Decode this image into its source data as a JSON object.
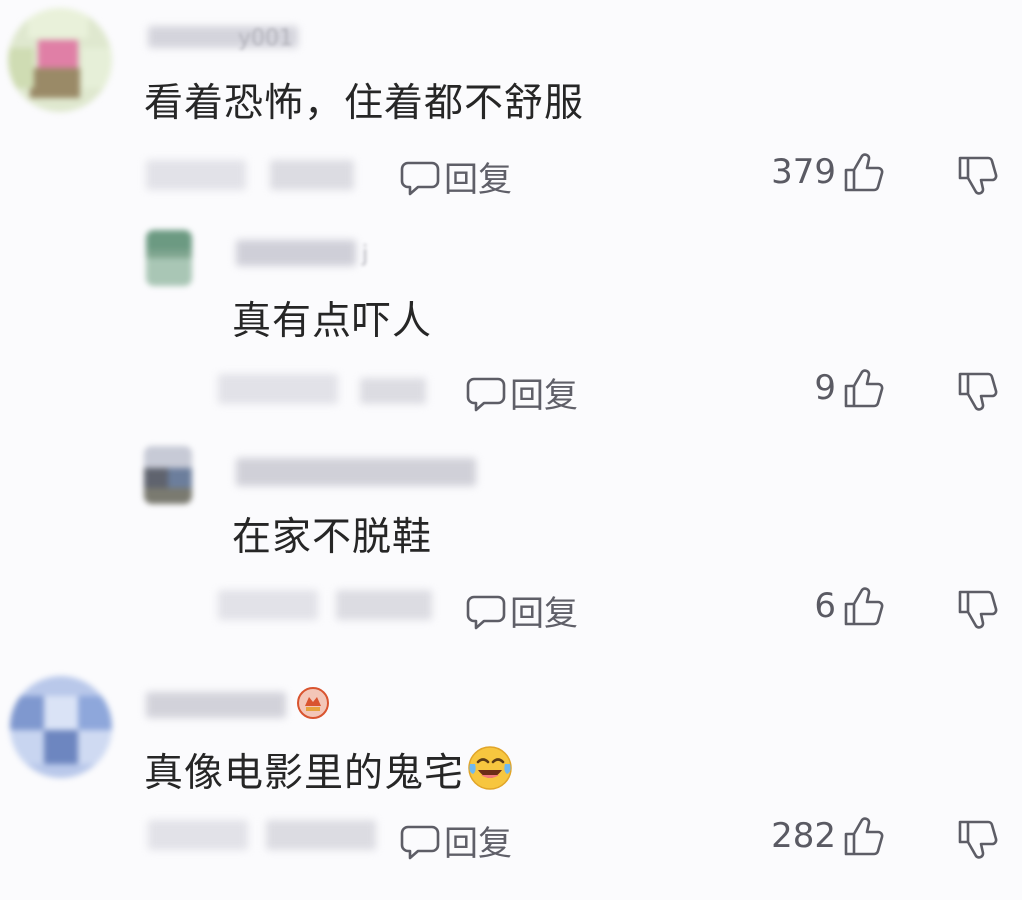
{
  "comments": [
    {
      "text": "看着恐怖，住着都不舒服",
      "reply_label": "回复",
      "likes": "379",
      "faint_name": "y001"
    },
    {
      "text": "真有点吓人",
      "reply_label": "回复",
      "likes": "9",
      "faint_name": "j"
    },
    {
      "text": "在家不脱鞋",
      "reply_label": "回复",
      "likes": "6"
    },
    {
      "text": "真像电影里的鬼宅",
      "reply_label": "回复",
      "likes": "282"
    }
  ],
  "icons": {
    "reply": "speech-bubble-icon",
    "like": "thumbs-up-icon",
    "dislike": "thumbs-down-icon",
    "emoji": "laughing-crying-emoji-icon",
    "badge": "level-badge-icon"
  },
  "colors": {
    "background": "#fbfbfd",
    "text": "#262626",
    "meta": "#5f5f68"
  }
}
